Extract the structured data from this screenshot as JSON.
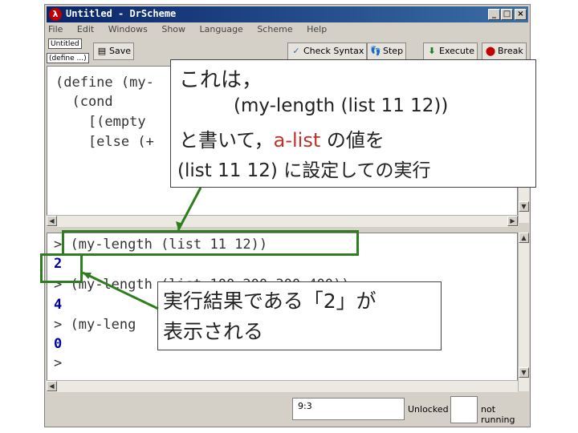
{
  "window": {
    "title": "Untitled - DrScheme",
    "app_icon_glyph": "λ",
    "controls": {
      "minimize": "_",
      "maximize": "□",
      "close": "×"
    }
  },
  "menubar": [
    "File",
    "Edit",
    "Windows",
    "Show",
    "Language",
    "Scheme",
    "Help"
  ],
  "toolbar": {
    "doc_name": "Untitled",
    "define_menu": "(define ...)",
    "save_label": "Save",
    "check_syntax_label": "Check Syntax",
    "step_label": "Step",
    "execute_label": "Execute",
    "break_label": "Break"
  },
  "editor": {
    "lines": [
      "(define (my-",
      "  (cond",
      "    [(empty",
      "    [else (+"
    ]
  },
  "interactions": {
    "lines": [
      {
        "prompt": ">",
        "text": " (my-length (list 11 12))"
      },
      {
        "prompt": "",
        "text": "2"
      },
      {
        "prompt": ">",
        "text": " (my-length (list 100 200 300 400))"
      },
      {
        "prompt": "",
        "text": "4"
      },
      {
        "prompt": ">",
        "text": " (my-leng"
      },
      {
        "prompt": "",
        "text": "0"
      },
      {
        "prompt": ">",
        "text": ""
      }
    ]
  },
  "status": {
    "position": "9:3",
    "lock": "Unlocked",
    "run_state": "not running"
  },
  "callout_top": {
    "line1": "これは，",
    "line2": "(my-length (list 11 12))",
    "line3_pre": "と書いて，",
    "line3_red": "a-list",
    "line3_post": " の値を",
    "line4": "(list 11 12) に設定しての実行"
  },
  "callout_bottom": {
    "line1": "実行結果である「2」が",
    "line2": "表示される"
  },
  "colors": {
    "titlebar": "#0a246a",
    "highlight": "#2e7d1e",
    "accent_red": "#c0302a",
    "output_blue": "#0000a0"
  }
}
